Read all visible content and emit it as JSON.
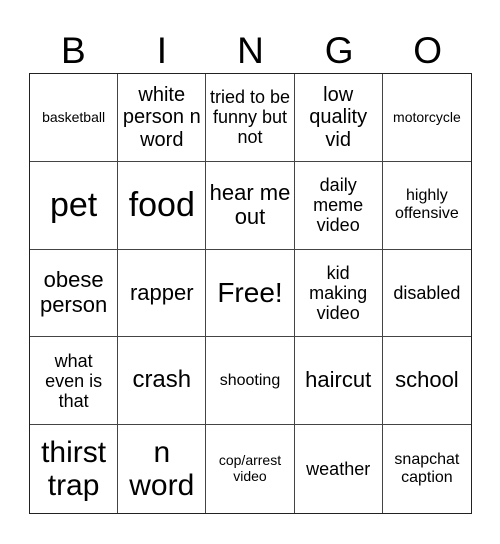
{
  "header": {
    "letters": [
      "B",
      "I",
      "N",
      "G",
      "O"
    ]
  },
  "grid": {
    "rows": [
      [
        "basketball",
        "white person n word",
        "tried to be funny but not",
        "low quality vid",
        "motorcycle"
      ],
      [
        "pet",
        "food",
        "hear me out",
        "daily meme video",
        "highly offensive"
      ],
      [
        "obese person",
        "rapper",
        "Free!",
        "kid making video",
        "disabled"
      ],
      [
        "what even is that",
        "crash",
        "shooting",
        "haircut",
        "school"
      ],
      [
        "thirst trap",
        "n word",
        "cop/arrest video",
        "weather",
        "snapchat caption"
      ]
    ],
    "free_space_label": "Free!"
  }
}
